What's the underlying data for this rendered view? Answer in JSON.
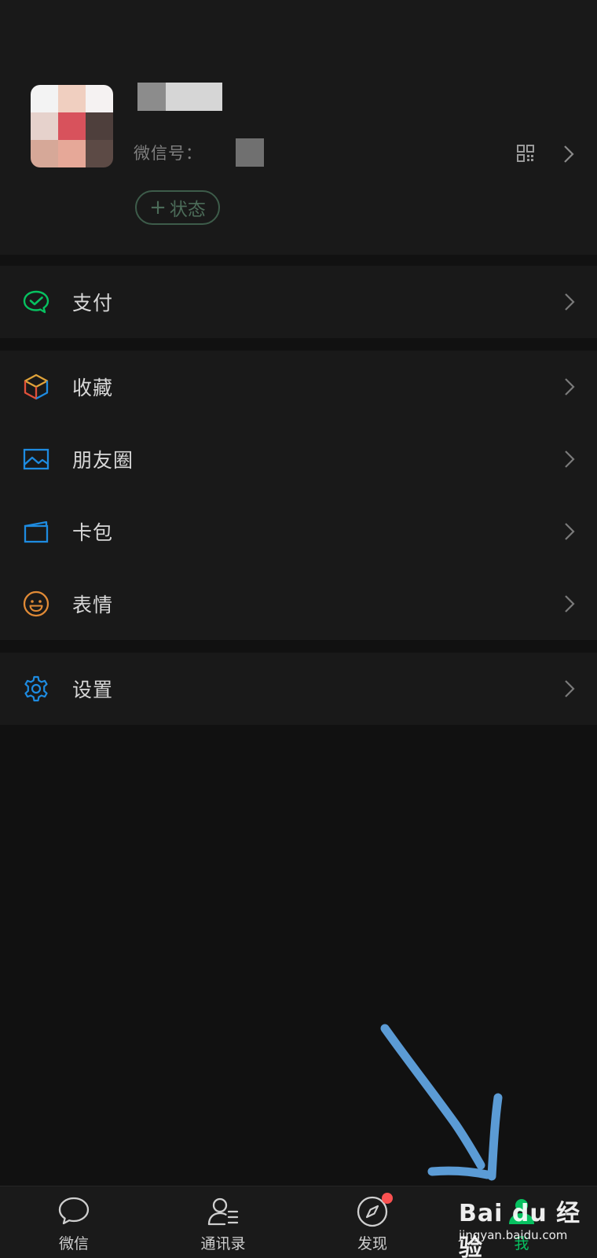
{
  "profile": {
    "wxid_label": "微信号：",
    "status_button": "状态",
    "status_plus": "+"
  },
  "menu": {
    "pay": "支付",
    "favorites": "收藏",
    "moments": "朋友圈",
    "cards": "卡包",
    "stickers": "表情",
    "settings": "设置"
  },
  "tabbar": {
    "chats": "微信",
    "contacts": "通讯录",
    "discover": "发现",
    "me": "我"
  },
  "watermark": {
    "brand": "Bai du 经验",
    "url": "jingyan.baidu.com"
  },
  "icons": {
    "pay": "wechat-pay-icon",
    "favorites": "cube-icon",
    "moments": "image-icon",
    "cards": "wallet-icon",
    "stickers": "smile-icon",
    "settings": "gear-icon"
  },
  "colors": {
    "accent_green": "#07c160",
    "pay_green": "#07c160",
    "moments_blue": "#1e8be0",
    "stickers_orange": "#e08a36",
    "settings_blue": "#1e8be0",
    "badge_red": "#fa5151",
    "annotation_arrow": "#5b9bd5"
  }
}
